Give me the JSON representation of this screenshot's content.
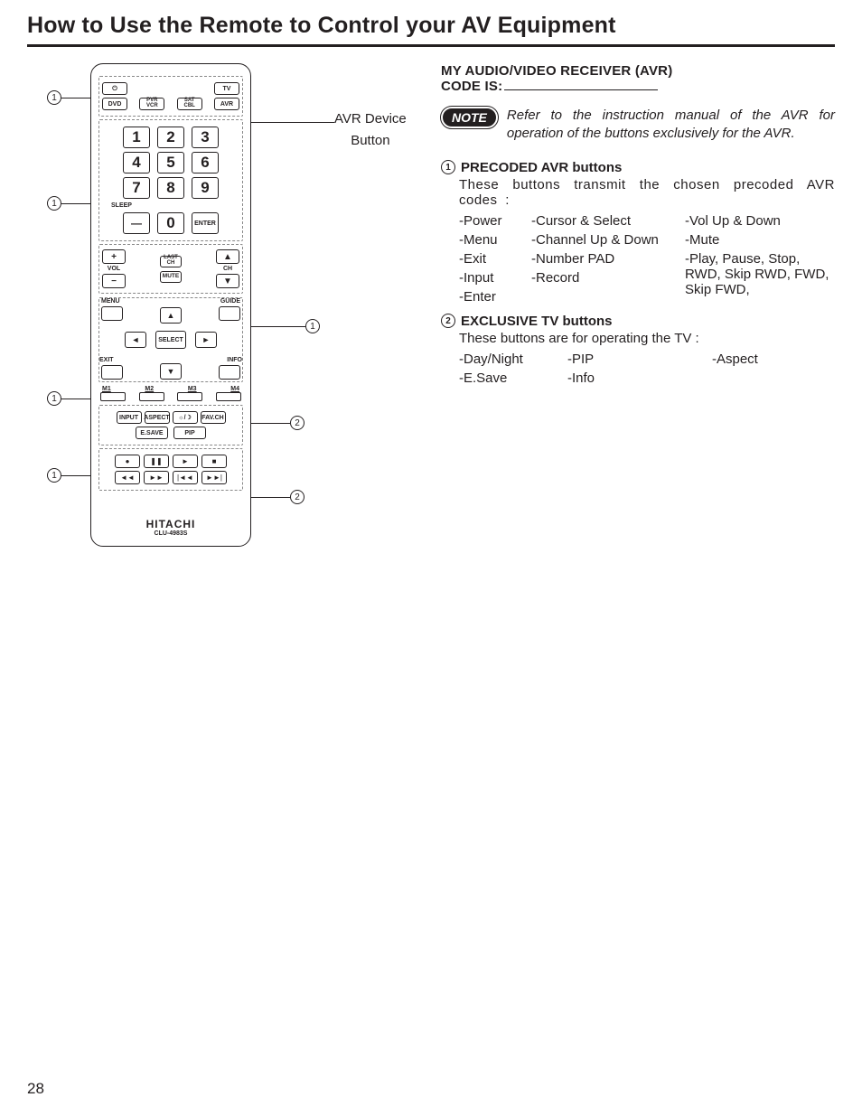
{
  "page": {
    "title": "How to Use the Remote to Control your AV Equipment",
    "number": "28"
  },
  "leftcol": {
    "avr_device_label_l1": "AVR Device",
    "avr_device_label_l2": "Button"
  },
  "remote": {
    "power": "⏻",
    "tv": "TV",
    "dvd": "DVD",
    "pvr_vcr_l1": "PVR",
    "pvr_vcr_l2": "VCR",
    "sat_cbl_l1": "SAT",
    "sat_cbl_l2": "CBL",
    "avr": "AVR",
    "n1": "1",
    "n2": "2",
    "n3": "3",
    "n4": "4",
    "n5": "5",
    "n6": "6",
    "n7": "7",
    "n8": "8",
    "n9": "9",
    "n0": "0",
    "sleep": "SLEEP",
    "dash": "—",
    "enter": "ENTER",
    "vol": "VOL",
    "ch": "CH",
    "lastch_l1": "LAST",
    "lastch_l2": "CH",
    "mute": "MUTE",
    "menu": "MENU",
    "guide": "GUIDE",
    "exit": "EXIT",
    "info": "INFO",
    "select": "SELECT",
    "up": "▲",
    "down": "▼",
    "left": "◄",
    "right": "►",
    "m1": "M1",
    "m2": "M2",
    "m3": "M3",
    "m4": "M4",
    "input": "INPUT",
    "aspect": "ASPECT",
    "daynight": "☼/☽",
    "favch": "FAV.CH",
    "esave": "E.SAVE",
    "pip": "PIP",
    "rec": "●",
    "pause": "❚❚",
    "play": "►",
    "stop": "■",
    "rwd": "◄◄",
    "fwd": "►►",
    "skiprwd": "|◄◄",
    "skipfwd": "►►|",
    "brand": "HITACHI",
    "model": "CLU-4983S"
  },
  "rightcol": {
    "avr_head_l1": "MY AUDIO/VIDEO RECEIVER (AVR)",
    "avr_head_l2": "CODE IS:",
    "note_badge": "NOTE",
    "note_text": "Refer to the instruction manual of the AVR for operation of the buttons exclusively for the AVR.",
    "sec1": {
      "num": "1",
      "title": "PRECODED AVR buttons",
      "sub": "These buttons transmit the chosen precoded AVR codes :",
      "c1r1": "-Power",
      "c2r1": "-Cursor & Select",
      "c3r1": "-Vol Up & Down",
      "c1r2": "-Menu",
      "c2r2": "-Channel Up & Down",
      "c3r2": "-Mute",
      "c1r3": "-Exit",
      "c2r3": "-Number PAD",
      "c3r3": "-Play, Pause, Stop, RWD, Skip RWD, FWD, Skip FWD,",
      "c1r4": "-Input",
      "c2r4": "-Record",
      "c1r5": "-Enter"
    },
    "sec2": {
      "num": "2",
      "title": "EXCLUSIVE TV buttons",
      "sub": "These buttons are for operating the TV :",
      "c1r1": "-Day/Night",
      "c2r1": "-PIP",
      "c3r1": "-Aspect",
      "c1r2": "-E.Save",
      "c2r2": "-Info"
    }
  }
}
